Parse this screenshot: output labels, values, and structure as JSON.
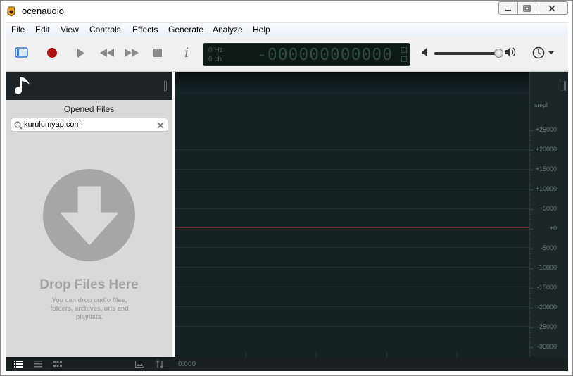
{
  "window": {
    "title": "ocenaudio"
  },
  "menu": [
    "File",
    "Edit",
    "View",
    "Controls",
    "Effects",
    "Generate",
    "Analyze",
    "Help"
  ],
  "toolbar": {
    "sidebar_toggle_icon": "sidebar-icon",
    "record_icon": "record-icon",
    "play_icon": "play-icon",
    "rewind_icon": "rewind-icon",
    "forward_icon": "fast-forward-icon",
    "stop_icon": "stop-icon",
    "info_label": "i",
    "volume_level": 0.85
  },
  "display": {
    "hz": "0 Hz",
    "ch": "0 ch",
    "time": "-000000000000"
  },
  "sidebar": {
    "title": "Opened Files",
    "search_value": "kurulumyap.com",
    "drop_title": "Drop Files Here",
    "drop_description": "You can drop audio files, folders, archives, urls and playlists."
  },
  "status": {
    "time": "0.000"
  },
  "ruler": {
    "unit": "smpl",
    "labels": [
      "+25000",
      "+20000",
      "+15000",
      "+10000",
      "+5000",
      "+0",
      "-5000",
      "-10000",
      "-15000",
      "-20000",
      "-25000",
      "-30000"
    ]
  },
  "colors": {
    "accent": "#3a78d6",
    "record": "#b01313",
    "waveform_bg": "#152223",
    "zero_line": "#6b2a20"
  }
}
